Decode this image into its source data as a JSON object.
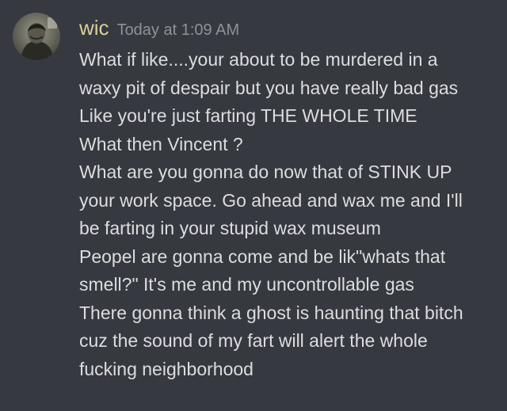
{
  "colors": {
    "background": "#36393f",
    "username": "#dbcf9a",
    "timestamp": "#8e9297",
    "text": "#dcddde"
  },
  "message": {
    "author": "wic",
    "timestamp": "Today at 1:09 AM",
    "avatar_icon": "user-avatar",
    "lines": [
      "What if like....your about to be murdered in a",
      "waxy pit of despair  but you have really bad gas",
      "Like you're  just farting THE WHOLE TIME",
      "What then Vincent ?",
      "What are you gonna do now that of STINK UP",
      "your work space. Go ahead and wax me and I'll",
      "be farting in your stupid wax museum",
      "Peopel are gonna come and be lik\"whats that",
      "smell?\" It's me and my uncontrollable gas",
      "There gonna think a ghost is haunting that bitch",
      "cuz the sound of my fart will alert the whole",
      "fucking neighborhood"
    ]
  }
}
